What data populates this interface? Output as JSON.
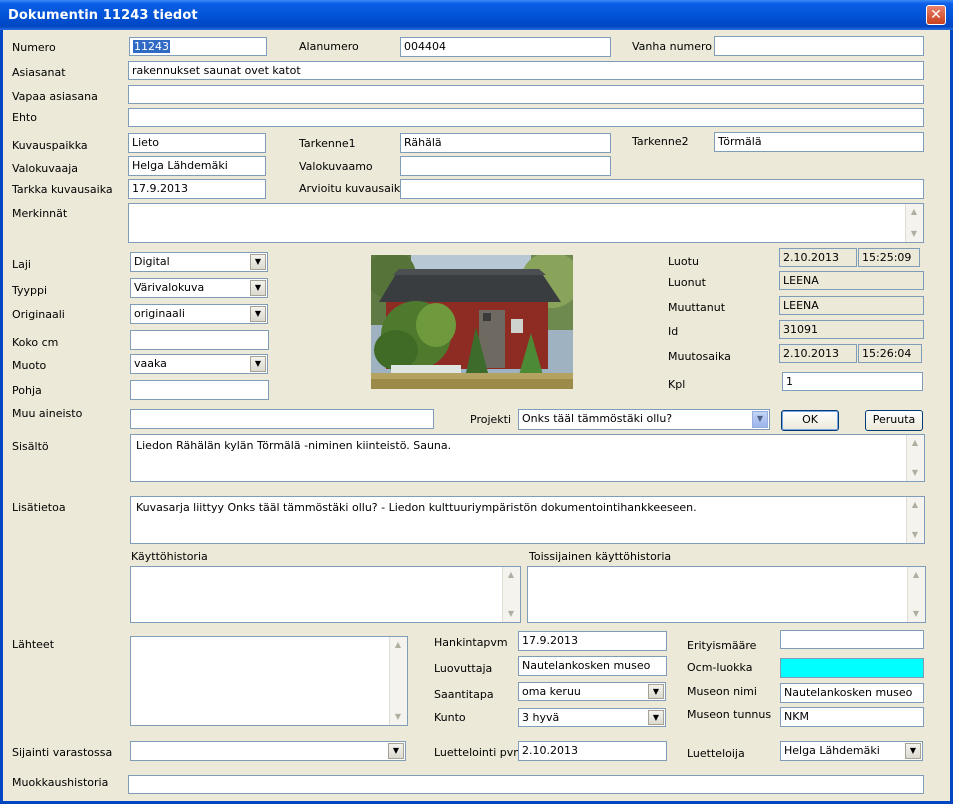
{
  "window": {
    "title": "Dokumentin 11243 tiedot",
    "close": "✕"
  },
  "row1": {
    "numero_label": "Numero",
    "numero": "11243",
    "alanumero_label": "Alanumero",
    "alanumero": "004404",
    "vanha_label": "Vanha numero",
    "vanha": ""
  },
  "asiasanat_label": "Asiasanat",
  "asiasanat": "rakennukset saunat ovet katot",
  "vapaa_label": "Vapaa asiasana",
  "vapaa": "",
  "ehto_label": "Ehto",
  "ehto": "",
  "kuvauspaikka_label": "Kuvauspaikka",
  "kuvauspaikka": "Lieto",
  "tarkenne1_label": "Tarkenne1",
  "tarkenne1": "Rähälä",
  "tarkenne2_label": "Tarkenne2",
  "tarkenne2": "Törmälä",
  "valokuvaaja_label": "Valokuvaaja",
  "valokuvaaja": "Helga Lähdemäki",
  "valokuvaamo_label": "Valokuvaamo",
  "valokuvaamo": "",
  "tarkka_label": "Tarkka kuvausaika",
  "tarkka": "17.9.2013",
  "arvioitu_label": "Arvioitu kuvausaika",
  "arvioitu": "",
  "merkinnat_label": "Merkinnät",
  "merkinnat": "",
  "laji_label": "Laji",
  "laji": "Digital",
  "tyyppi_label": "Tyyppi",
  "tyyppi": "Värivalokuva",
  "originaali_label": "Originaali",
  "originaali": "originaali",
  "koko_label": "Koko cm",
  "koko": "",
  "muoto_label": "Muoto",
  "muoto": "vaaka",
  "pohja_label": "Pohja",
  "pohja": "",
  "muu_label": "Muu aineisto",
  "muu": "",
  "meta": {
    "luotu_label": "Luotu",
    "luotu_date": "2.10.2013",
    "luotu_time": "15:25:09",
    "luonut_label": "Luonut",
    "luonut": "LEENA",
    "muuttanut_label": "Muuttanut",
    "muuttanut": "LEENA",
    "id_label": "Id",
    "id": "31091",
    "muutosaika_label": "Muutosaika",
    "muutos_date": "2.10.2013",
    "muutos_time": "15:26:04",
    "kpl_label": "Kpl",
    "kpl": "1"
  },
  "projekti_label": "Projekti",
  "projekti": "Onks tääl tämmöstäki ollu?",
  "ok": "OK",
  "peruuta": "Peruuta",
  "sisalto_label": "Sisältö",
  "sisalto": "Liedon Rähälän kylän Törmälä -niminen kiinteistö. Sauna.",
  "lisatietoa_label": "Lisätietoa",
  "lisatietoa": "Kuvasarja liittyy Onks tääl tämmöstäki ollu? - Liedon kulttuuriympäristön dokumentointihankkeeseen.",
  "kaytto_label": "Käyttöhistoria",
  "kaytto": "",
  "toissijainen_label": "Toissijainen käyttöhistoria",
  "toissijainen": "",
  "lahteet_label": "Lähteet",
  "lahteet": "",
  "hankinta_label": "Hankintapvm",
  "hankinta": "17.9.2013",
  "luovuttaja_label": "Luovuttaja",
  "luovuttaja": "Nautelankosken museo",
  "saantitapa_label": "Saantitapa",
  "saantitapa": "oma keruu",
  "kunto_label": "Kunto",
  "kunto": "3 hyvä",
  "erityis_label": "Erityismääre",
  "erityis": "",
  "ocm_label": "Ocm-luokka",
  "ocm": "",
  "museonimi_label": "Museon nimi",
  "museonimi": "Nautelankosken museo",
  "museotunnus_label": "Museon tunnus",
  "museotunnus": "NKM",
  "sijainti_label": "Sijainti varastossa",
  "sijainti": "",
  "luettelointi_label": "Luettelointi pvm",
  "luettelointi": "2.10.2013",
  "luetteloija_label": "Luetteloija",
  "luetteloija": "Helga Lähdemäki",
  "muokkaus_label": "Muokkaushistoria",
  "muokkaus": "",
  "colors": {
    "titlebar": "#0254d8",
    "dialog_bg": "#ece9d8",
    "ocm_field": "#00ffff",
    "field_border": "#7f9db9"
  },
  "icons": {
    "dropdown": "chevron-down-icon",
    "scroll_up": "scroll-up-icon",
    "scroll_down": "scroll-down-icon"
  }
}
